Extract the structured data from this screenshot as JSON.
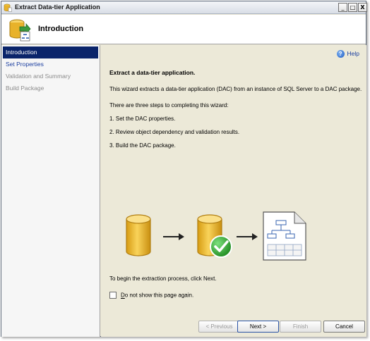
{
  "window": {
    "title": "Extract Data-tier Application",
    "controls": {
      "minimize": "_",
      "maximize": "□",
      "close": "X"
    }
  },
  "header": {
    "title": "Introduction"
  },
  "sidebar": {
    "items": [
      {
        "label": "Introduction",
        "state": "active"
      },
      {
        "label": "Set Properties",
        "state": "link"
      },
      {
        "label": "Validation and Summary",
        "state": "disabled"
      },
      {
        "label": "Build Package",
        "state": "disabled"
      }
    ]
  },
  "content": {
    "help_label": "Help",
    "heading": "Extract a data-tier application.",
    "description": "This wizard extracts a data-tier application (DAC) from an instance of SQL Server to a DAC package.",
    "steps_intro": "There are three steps to completing this wizard:",
    "steps": [
      "1. Set the DAC properties.",
      "2. Review object dependency and validation results.",
      "3. Build the DAC package."
    ],
    "begin_text": "To begin the extraction process, click Next.",
    "checkbox": {
      "mnemonic": "D",
      "rest": "o not show this page again.",
      "checked": false
    }
  },
  "buttons": {
    "previous": "< Previous",
    "next": "Next >",
    "finish": "Finish",
    "cancel": "Cancel"
  },
  "colors": {
    "nav_active_bg": "#0a246a",
    "link": "#1c3fa0",
    "disabled": "#8c8c8c",
    "database_gold": "#e8b22a",
    "check_green": "#2e9e2e"
  },
  "icons": [
    "app-database-icon",
    "database-icon",
    "arrow-right-icon",
    "check-icon",
    "document-diagram-icon",
    "help-icon"
  ]
}
